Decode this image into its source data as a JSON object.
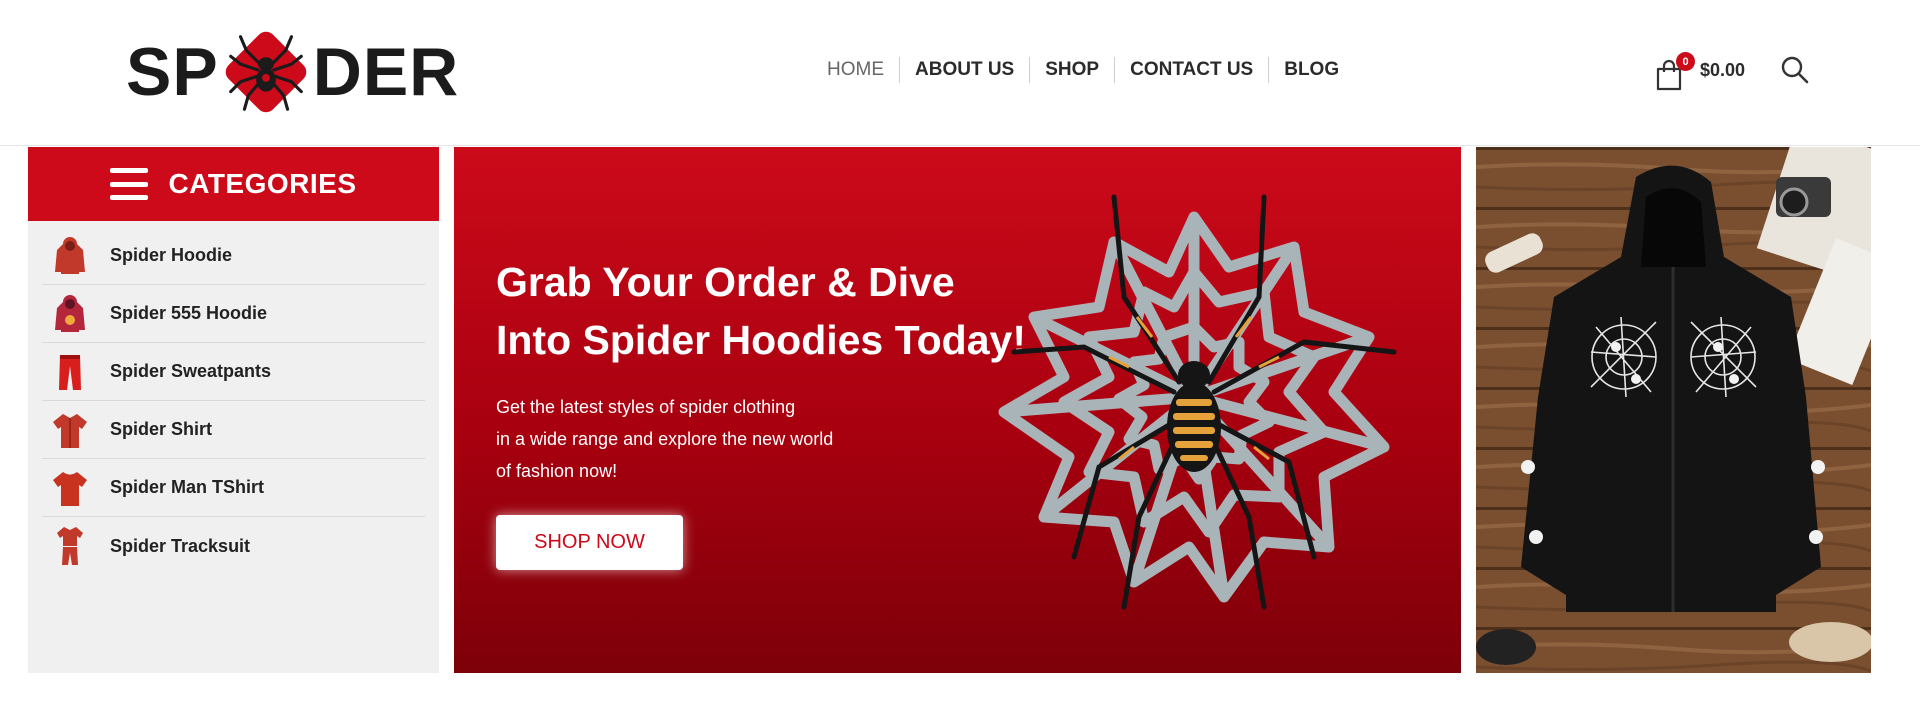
{
  "logo": {
    "text_left": "SP",
    "text_right": "DER",
    "alt": "SPIDER"
  },
  "nav": {
    "items": [
      "HOME",
      "ABOUT US",
      "SHOP",
      "CONTACT US",
      "BLOG"
    ]
  },
  "cart": {
    "count": "0",
    "total": "$0.00",
    "icon": "shopping-bag-icon"
  },
  "search": {
    "icon": "search-icon"
  },
  "categories": {
    "title": "CATEGORIES",
    "items": [
      {
        "label": "Spider Hoodie",
        "icon": "hoodie-icon"
      },
      {
        "label": "Spider 555 Hoodie",
        "icon": "hoodie-555-icon"
      },
      {
        "label": "Spider Sweatpants",
        "icon": "sweatpants-icon"
      },
      {
        "label": "Spider Shirt",
        "icon": "shirt-icon"
      },
      {
        "label": "Spider Man TShirt",
        "icon": "tshirt-icon"
      },
      {
        "label": "Spider Tracksuit",
        "icon": "tracksuit-icon"
      }
    ]
  },
  "hero": {
    "title_line1": "Grab Your Order & Dive",
    "title_line2": "Into Spider Hoodies Today!",
    "desc_line1": "Get the latest styles of spider clothing",
    "desc_line2": "in a wide range and explore the new world",
    "desc_line3": "of fashion now!",
    "cta": "SHOP NOW"
  },
  "colors": {
    "brand_red": "#cc0a1a",
    "dark_text": "#222222",
    "panel_gray": "#f0f0f0"
  }
}
